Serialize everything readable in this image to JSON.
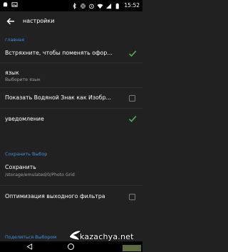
{
  "status_bar": {
    "time": "15:52"
  },
  "toolbar": {
    "title": "настройки"
  },
  "settings": {
    "cat_main": "главная",
    "shake": {
      "title": "Встряхните, чтобы поменять офор...",
      "checked": true
    },
    "language": {
      "title": "язык",
      "summary": "Выберите язык"
    },
    "watermark": {
      "title": "Показать Водяной Знак как Изобр...",
      "checked": false
    },
    "notification": {
      "title": "уведомление",
      "checked": true
    },
    "cat_save": "Сохранить Выбор",
    "save": {
      "title": "Сохранить",
      "summary": "/storage/emulated/0/Photo Grid"
    },
    "optimize": {
      "title": "Оптимизация выходного фильтра",
      "checked": false
    },
    "cat_share": "Поделиться Выбором"
  },
  "watermark_overlay": {
    "text": "kazachya.net",
    "badge": ""
  },
  "colors": {
    "accent": "#3d8fe0",
    "check": "#4caf50",
    "background": "#212121"
  },
  "icons": [
    "bluetooth-icon",
    "vibrate-icon",
    "alarm-icon",
    "wifi-icon",
    "signal-icon",
    "battery-icon",
    "back-arrow-icon",
    "checkmark-icon"
  ]
}
